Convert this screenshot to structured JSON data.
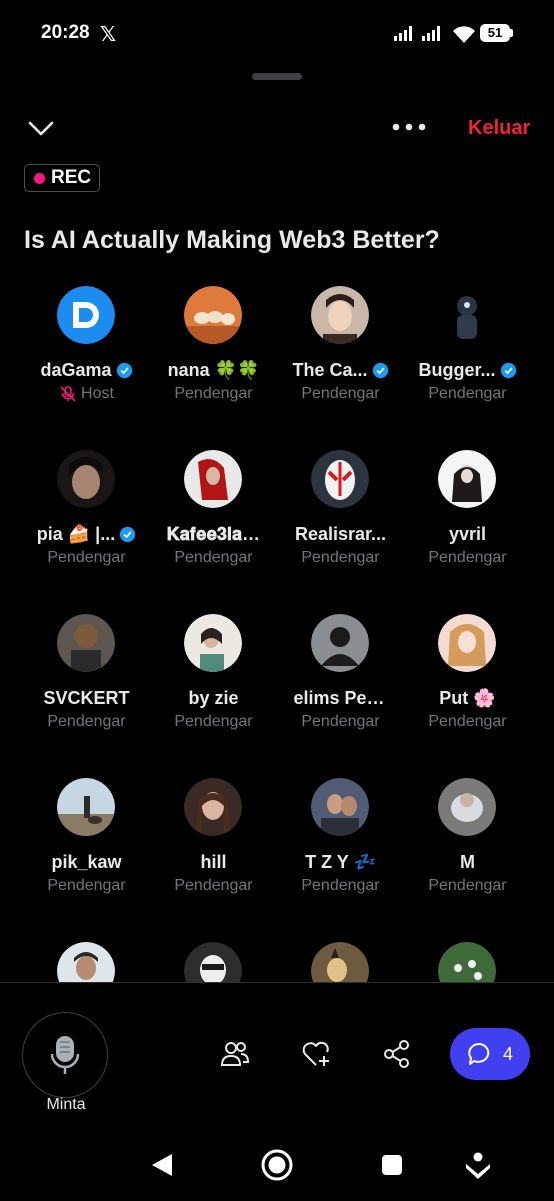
{
  "status_bar": {
    "time": "20:28",
    "battery": "51"
  },
  "header": {
    "leave_label": "Keluar",
    "rec_label": "REC"
  },
  "space": {
    "title": "Is AI Actually Making Web3 Better?"
  },
  "colors": {
    "accent": "#4040f0",
    "leave": "#f4212e",
    "rec_dot": "#f91880",
    "verified": "#1d9bf0",
    "muted": "#71767b"
  },
  "participants": [
    {
      "name": "daGama",
      "verified": true,
      "role": "Host",
      "muted_mic": true
    },
    {
      "name": "nana 🍀🍀",
      "verified": false,
      "role": "Pendengar"
    },
    {
      "name": "The Ca...",
      "verified": true,
      "role": "Pendengar"
    },
    {
      "name": "Bugger...",
      "verified": true,
      "role": "Pendengar"
    },
    {
      "name": "pia 🍰 |...",
      "verified": true,
      "role": "Pendengar"
    },
    {
      "name": "𝐊𝐚𝐟𝐞𝐞𝟑𝐥𝐚𝐡 ...",
      "verified": false,
      "role": "Pendengar"
    },
    {
      "name": "Realisrar...",
      "verified": false,
      "role": "Pendengar"
    },
    {
      "name": "yvril",
      "verified": false,
      "role": "Pendengar"
    },
    {
      "name": "SVCKERT",
      "verified": false,
      "role": "Pendengar"
    },
    {
      "name": "by zie",
      "verified": false,
      "role": "Pendengar"
    },
    {
      "name": "elims Pee...",
      "verified": false,
      "role": "Pendengar"
    },
    {
      "name": "Put 🌸",
      "verified": false,
      "role": "Pendengar"
    },
    {
      "name": "pik_kaw",
      "verified": false,
      "role": "Pendengar"
    },
    {
      "name": "hill",
      "verified": false,
      "role": "Pendengar"
    },
    {
      "name": "T Z Y 💤",
      "verified": false,
      "role": "Pendengar"
    },
    {
      "name": "M",
      "verified": false,
      "role": "Pendengar"
    }
  ],
  "bottom_bar": {
    "request_label": "Minta",
    "comment_count": "4"
  }
}
